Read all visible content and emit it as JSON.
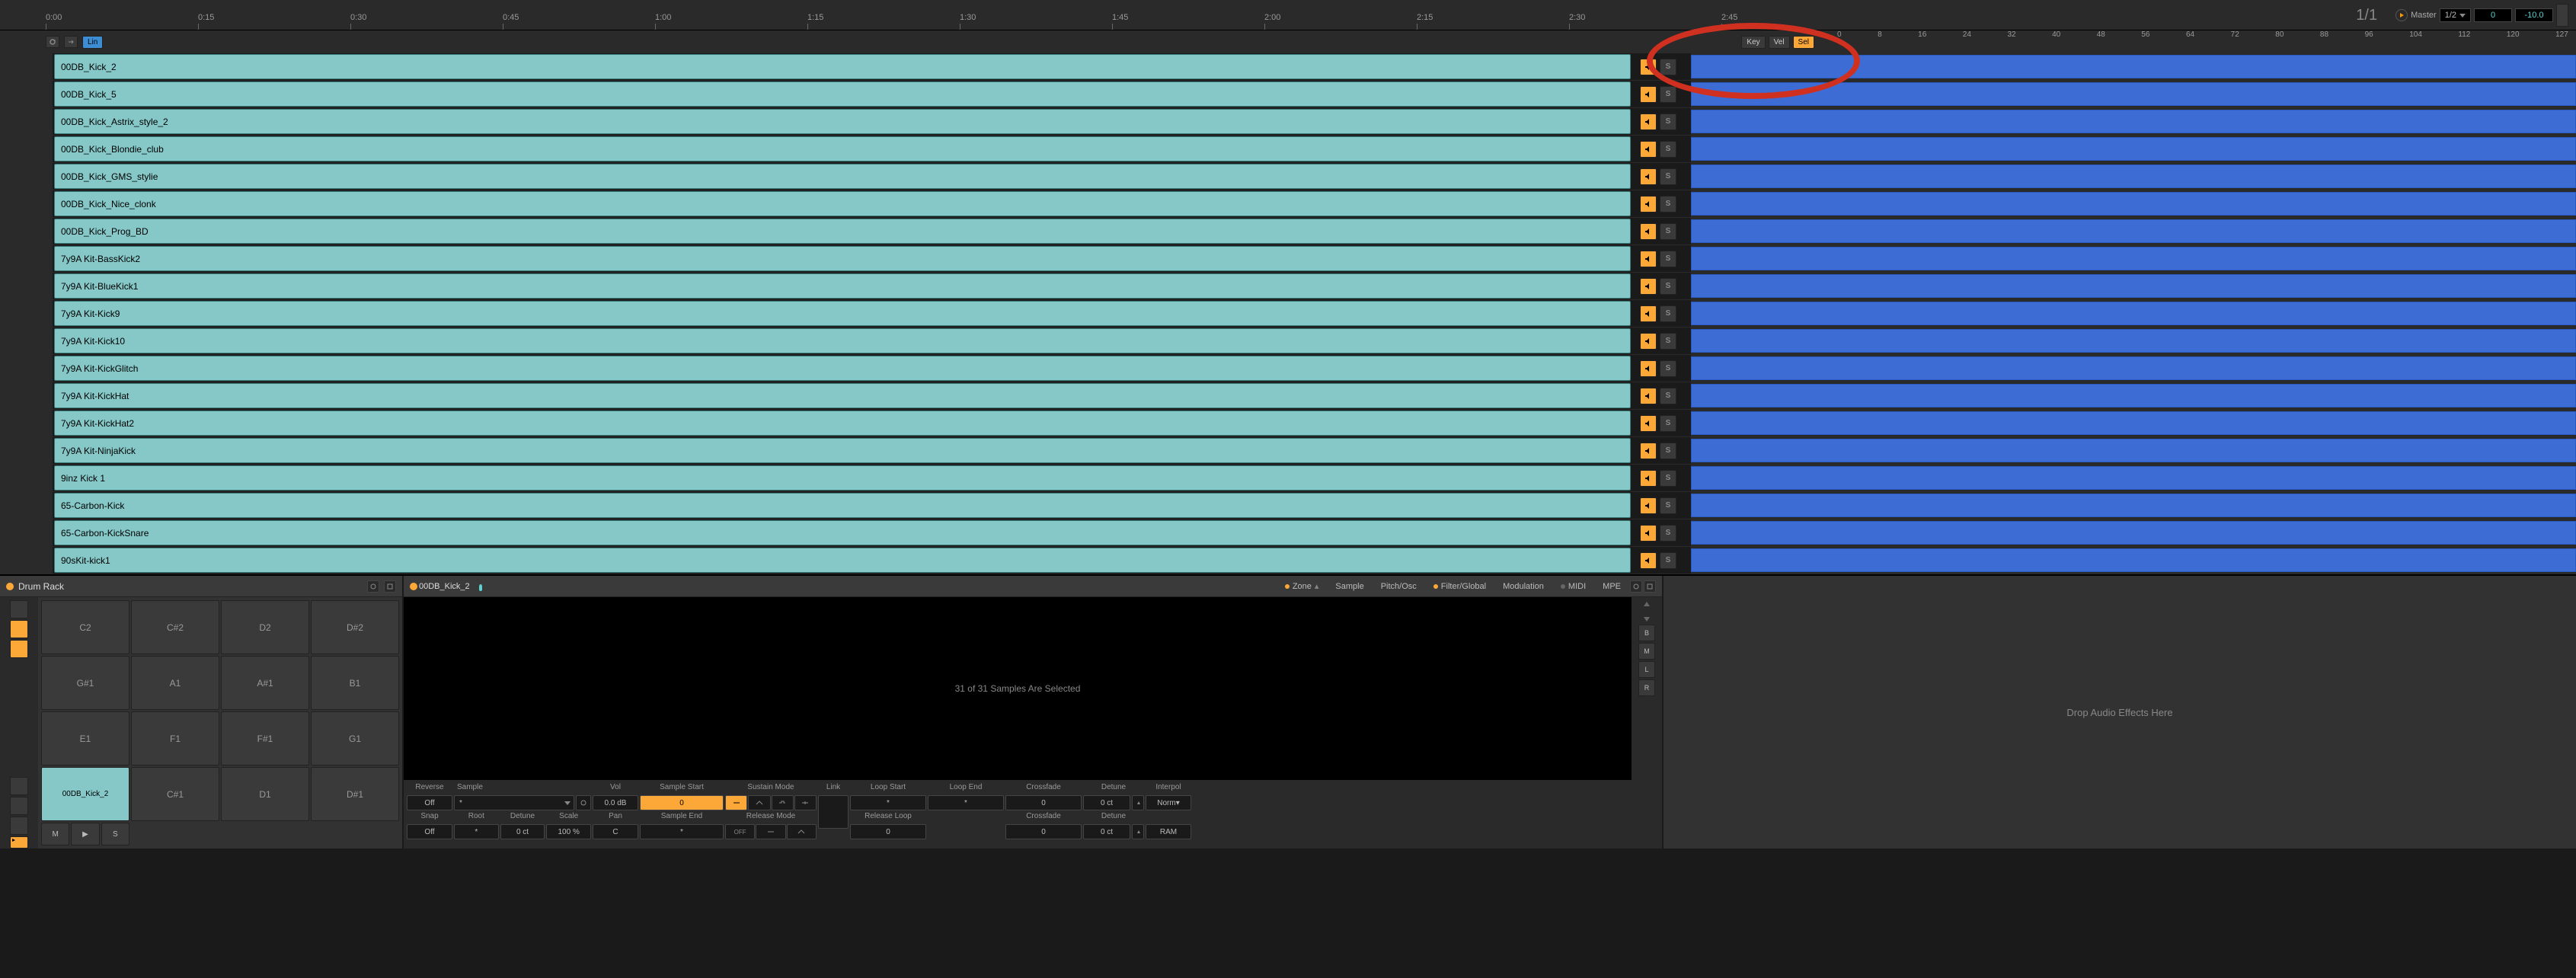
{
  "timeline": {
    "ticks": [
      "0:00",
      "0:15",
      "0:30",
      "0:45",
      "1:00",
      "1:15",
      "1:30",
      "1:45",
      "2:00",
      "2:15",
      "2:30",
      "2:45"
    ],
    "position_display": "1/1"
  },
  "master": {
    "label": "Master",
    "time_sig": "1/2",
    "value1": "0",
    "value2": "-10.0"
  },
  "zone_header": {
    "lin_btn": "Lin",
    "key_btn": "Key",
    "vel_btn": "Vel",
    "sel_btn": "Sel",
    "key_numbers": [
      "0",
      "8",
      "16",
      "24",
      "32",
      "40",
      "48",
      "56",
      "64",
      "72",
      "80",
      "88",
      "96",
      "104",
      "112",
      "120",
      "127"
    ]
  },
  "samples": [
    {
      "name": "00DB_Kick_2"
    },
    {
      "name": "00DB_Kick_5"
    },
    {
      "name": "00DB_Kick_Astrix_style_2"
    },
    {
      "name": "00DB_Kick_Blondie_club"
    },
    {
      "name": "00DB_Kick_GMS_stylie"
    },
    {
      "name": "00DB_Kick_Nice_clonk"
    },
    {
      "name": "00DB_Kick_Prog_BD"
    },
    {
      "name": "7y9A Kit-BassKick2"
    },
    {
      "name": "7y9A Kit-BlueKick1"
    },
    {
      "name": "7y9A Kit-Kick9"
    },
    {
      "name": "7y9A Kit-Kick10"
    },
    {
      "name": "7y9A Kit-KickGlitch"
    },
    {
      "name": "7y9A Kit-KickHat"
    },
    {
      "name": "7y9A Kit-KickHat2"
    },
    {
      "name": "7y9A Kit-NinjaKick"
    },
    {
      "name": "9inz Kick 1"
    },
    {
      "name": "65-Carbon-Kick"
    },
    {
      "name": "65-Carbon-KickSnare"
    },
    {
      "name": "90sKit-kick1"
    }
  ],
  "ms": {
    "mute_icon": "◀",
    "solo_label": "S"
  },
  "drum_rack": {
    "title": "Drum Rack",
    "pads": [
      [
        "C2",
        "C#2",
        "D2",
        "D#2"
      ],
      [
        "G#1",
        "A1",
        "A#1",
        "B1"
      ],
      [
        "E1",
        "F1",
        "F#1",
        "G1"
      ],
      [
        "00DB_Kick_2",
        "C#1",
        "D1",
        "D#1"
      ]
    ],
    "footer": {
      "m": "M",
      "play": "▶",
      "s": "S"
    }
  },
  "sampler": {
    "title": "00DB_Kick_2",
    "tabs": {
      "zone": "Zone",
      "sample": "Sample",
      "pitch": "Pitch/Osc",
      "filter": "Filter/Global",
      "modulation": "Modulation",
      "midi": "MIDI",
      "mpe": "MPE"
    },
    "display_text": "31 of 31 Samples Are Selected",
    "right_btns": {
      "b": "B",
      "m": "M",
      "l": "L",
      "r": "R"
    },
    "params": {
      "reverse": {
        "label": "Reverse",
        "value": "Off"
      },
      "snap": {
        "label": "Snap",
        "value": "Off"
      },
      "sample": {
        "label": "Sample",
        "value": "*"
      },
      "root": {
        "label": "Root",
        "value": "*"
      },
      "detune1": {
        "label": "Detune",
        "value": "0 ct"
      },
      "scale": {
        "label": "Scale",
        "value": "100 %"
      },
      "vol": {
        "label": "Vol",
        "value": "0.0 dB"
      },
      "pan": {
        "label": "Pan",
        "value": "C"
      },
      "sample_start": {
        "label": "Sample Start",
        "value": "0"
      },
      "sample_end": {
        "label": "Sample End",
        "value": "*"
      },
      "sustain_mode": {
        "label": "Sustain Mode"
      },
      "release_mode": {
        "label": "Release Mode"
      },
      "link": {
        "label": "Link"
      },
      "loop_start": {
        "label": "Loop Start",
        "value": "*"
      },
      "release_loop": {
        "label": "Release Loop",
        "value": "0"
      },
      "loop_end": {
        "label": "Loop End",
        "value": "*"
      },
      "crossfade1": {
        "label": "Crossfade",
        "value": "0"
      },
      "crossfade2": {
        "label": "Crossfade",
        "value": "0"
      },
      "detune2": {
        "label": "Detune",
        "value": "0 ct"
      },
      "detune3": {
        "label": "Detune",
        "value": "0 ct"
      },
      "interpol": {
        "label": "Interpol",
        "value": "Norm▾"
      },
      "ram": {
        "label": "RAM"
      }
    }
  },
  "drop_area": {
    "text": "Drop Audio Effects Here"
  }
}
